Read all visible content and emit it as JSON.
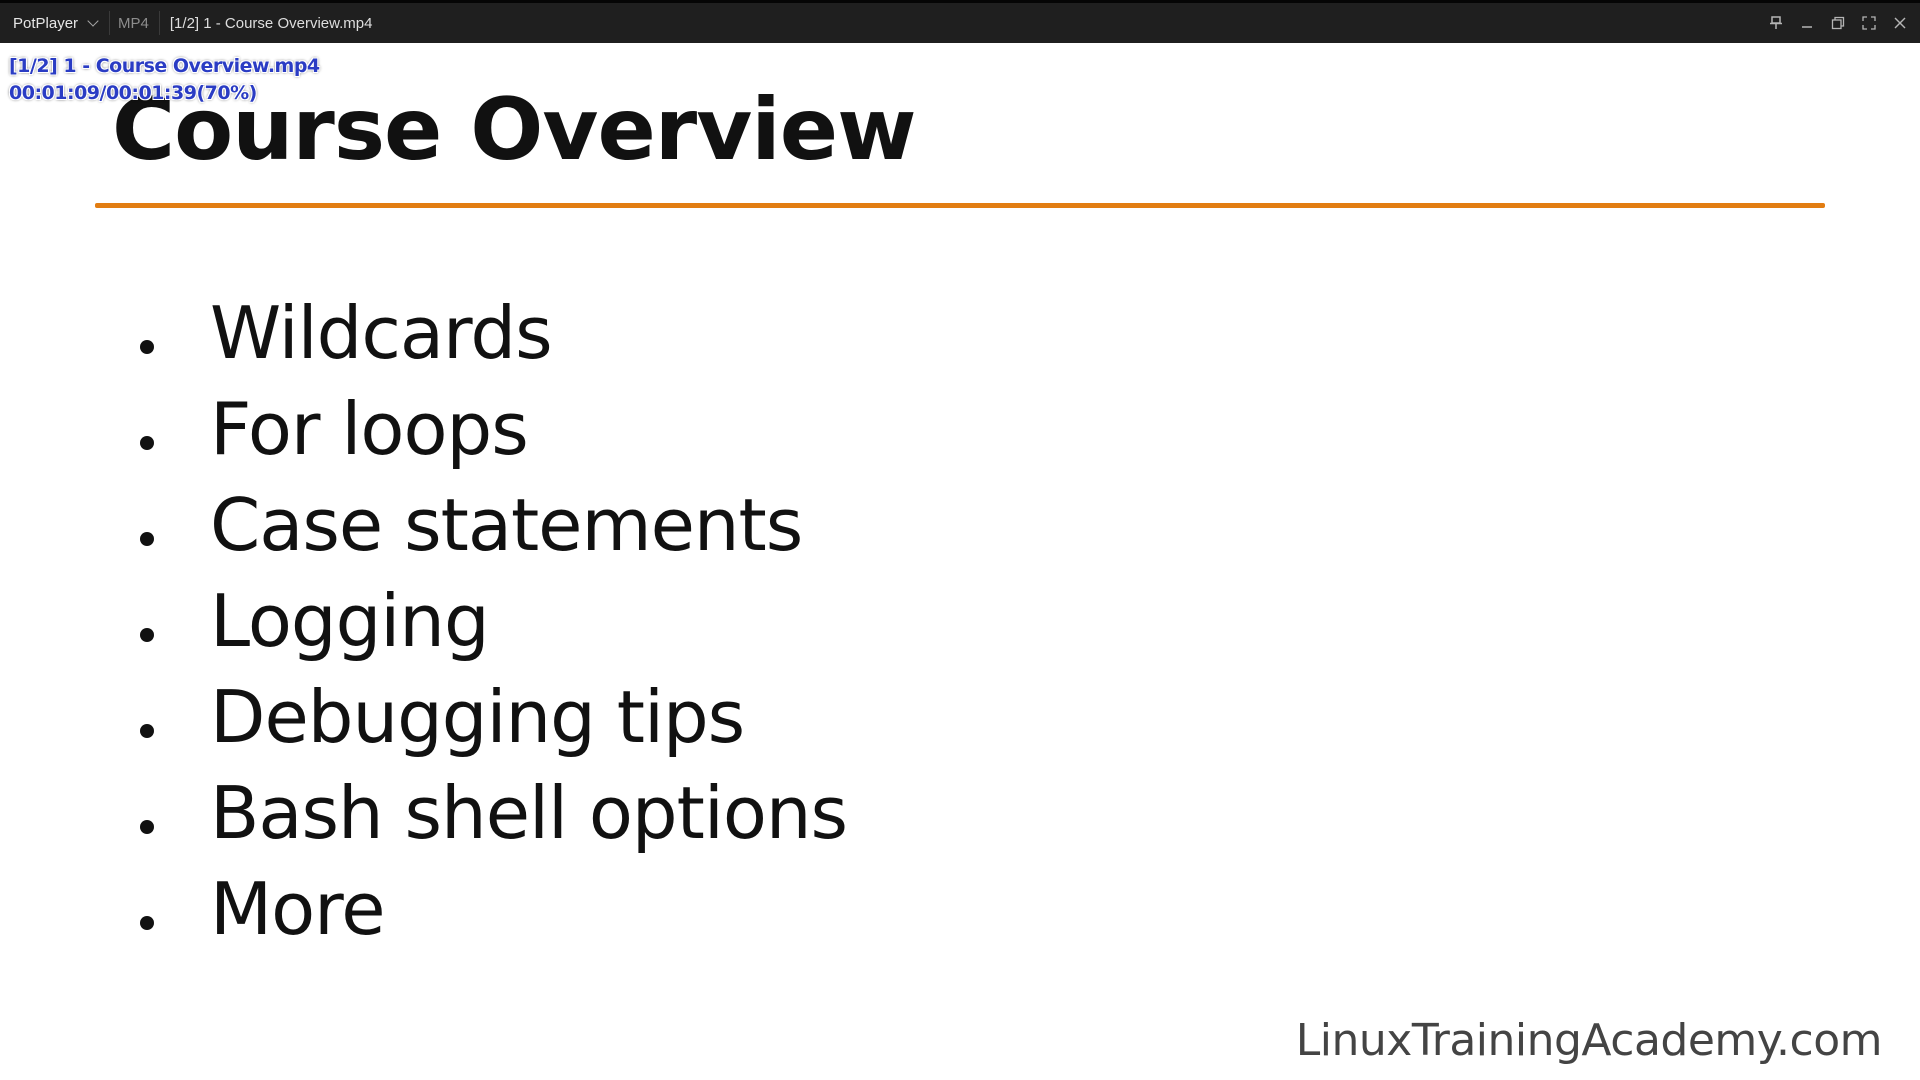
{
  "titlebar": {
    "app_name": "PotPlayer",
    "format": "MP4",
    "title": "[1/2] 1 - Course Overview.mp4",
    "controls": [
      "pin-icon",
      "minimize-icon",
      "restore-icon",
      "fullscreen-icon",
      "close-icon"
    ]
  },
  "osd": {
    "filename": "[1/2] 1 - Course Overview.mp4",
    "time": "00:01:09/00:01:39(70%)"
  },
  "slide": {
    "title": "Course Overview",
    "bullets": [
      "Wildcards",
      "For loops",
      "Case statements",
      "Logging",
      "Debugging tips",
      "Bash shell options",
      "More"
    ],
    "watermark": "LinuxTrainingAcademy.com",
    "accent_color": "#e27d12"
  }
}
